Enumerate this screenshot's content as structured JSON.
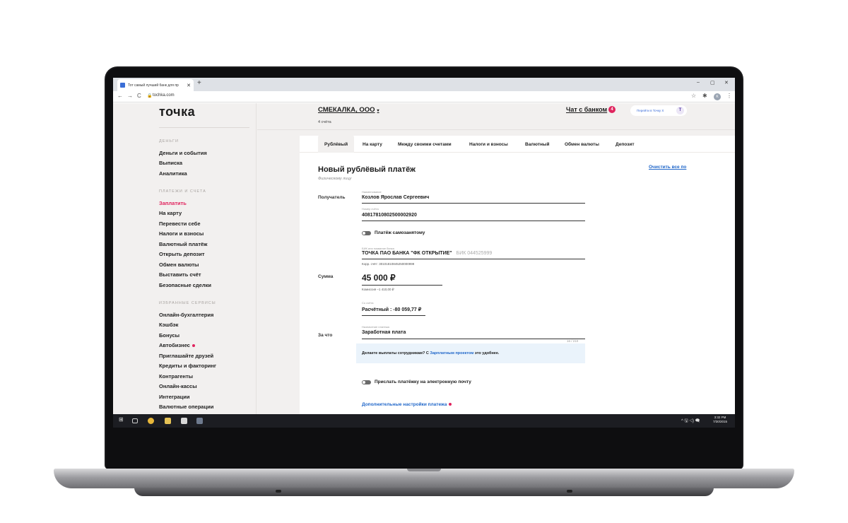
{
  "browser": {
    "tab_title": "Тот самый лучший банк для пр",
    "tab_close": "✕",
    "new_tab": "+",
    "url": "tochka.com",
    "controls": {
      "minimize": "–",
      "maximize": "▢",
      "close": "✕"
    },
    "nav": {
      "back": "←",
      "forward": "→",
      "reload": "C",
      "lock": "🔒",
      "star": "☆",
      "extensions": "✱",
      "menu": "⋮"
    },
    "profile_initial": "K"
  },
  "sidebar": {
    "logo": "точка",
    "sections": [
      {
        "title": "ДЕНЬГИ",
        "items": [
          "Деньги и события",
          "Выписка",
          "Аналитика"
        ]
      },
      {
        "title": "ПЛАТЕЖИ И СЧЕТА",
        "items": [
          "Заплатить",
          "На карту",
          "Перевести себе",
          "Налоги и взносы",
          "Валютный платёж",
          "Открыть депозит",
          "Обмен валюты",
          "Выставить счёт",
          "Безопасные сделки"
        ]
      },
      {
        "title": "ИЗБРАННЫЕ СЕРВИСЫ",
        "items": [
          "Онлайн-бухгалтерия",
          "Кэшбэк",
          "Бонусы",
          "Автобизнес",
          "Приглашайте друзей",
          "Кредиты и факторинг",
          "Контрагенты",
          "Онлайн-кассы",
          "Интеграции",
          "Валютные операции"
        ]
      }
    ],
    "active_item": "Заплатить",
    "accent_color": "#e0245e"
  },
  "header": {
    "company": "СМЕКАЛКА, ООО",
    "accounts": "4 счёта",
    "chat": "Чат с банком",
    "chat_badge": "4",
    "goto_button": "Перейти в Точку X",
    "goto_icon_letter": "T"
  },
  "payment_tabs": [
    "Рублёвый",
    "На карту",
    "Между своими счетами",
    "Налоги и взносы",
    "Валютный",
    "Обмен валюты",
    "Депозит"
  ],
  "form": {
    "title": "Новый рублёвый платёж",
    "subtitle": "Физическому лицу",
    "clear_all": "Очистить все по",
    "recipient_label": "Получатель",
    "name_caption": "Наименование",
    "name_value": "Козлов Ярослав Сергеевич",
    "account_caption": "Номер счёта",
    "account_value": "40817810802500002920",
    "self_employed_toggle": "Платёж самозанятому",
    "bank_caption": "БИК или название банка",
    "bank_value": "ТОЧКА ПАО БАНКА \"ФК ОТКРЫТИЕ\"",
    "bik_value": "БИК 044525999",
    "corr_account": "Корр. счёт: 30101810845250000999",
    "amount_label": "Сумма",
    "amount_value": "45 000 ₽",
    "commission": "Комиссия –1 410,00 ₽",
    "from_caption": "Со счёта",
    "from_value": "Расчётный : -80 059,77 ₽",
    "purpose_label": "За что",
    "purpose_caption": "Назначение платежа",
    "purpose_value": "Заработная плата",
    "purpose_counter": "16 / 210",
    "banner_before": "Делаете выплаты сотрудникам? С ",
    "banner_link": "Зарплатным проектом",
    "banner_after": " это удобнее.",
    "email_toggle": "Прислать платёжку на электронную почту",
    "more_settings": "Дополнительные настройки платежа",
    "link_color": "#1f66c9"
  },
  "taskbar": {
    "tray": "^ 🖫 ◁) 🗨",
    "time": "3:32 PM",
    "date": "7/30/2015"
  }
}
